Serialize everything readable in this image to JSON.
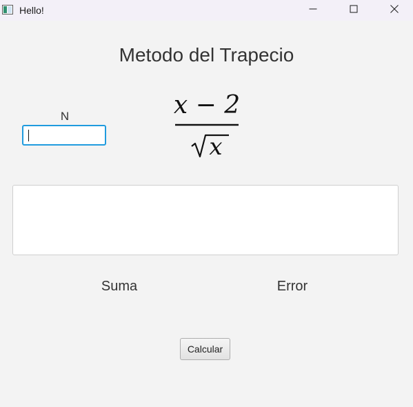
{
  "window": {
    "title": "Hello!"
  },
  "main": {
    "heading": "Metodo del Trapecio",
    "n_label": "N",
    "n_value": "",
    "formula": {
      "numerator": "x − 2",
      "denominator_var": "x"
    },
    "result_text": "",
    "suma_label": "Suma",
    "error_label": "Error",
    "calcular_label": "Calcular"
  },
  "colors": {
    "focus_border": "#1f9bde",
    "background": "#f3f3f3",
    "titlebar": "#f3f0f8"
  },
  "icons": [
    "app-window-icon",
    "minimize-icon",
    "maximize-icon",
    "close-icon"
  ]
}
